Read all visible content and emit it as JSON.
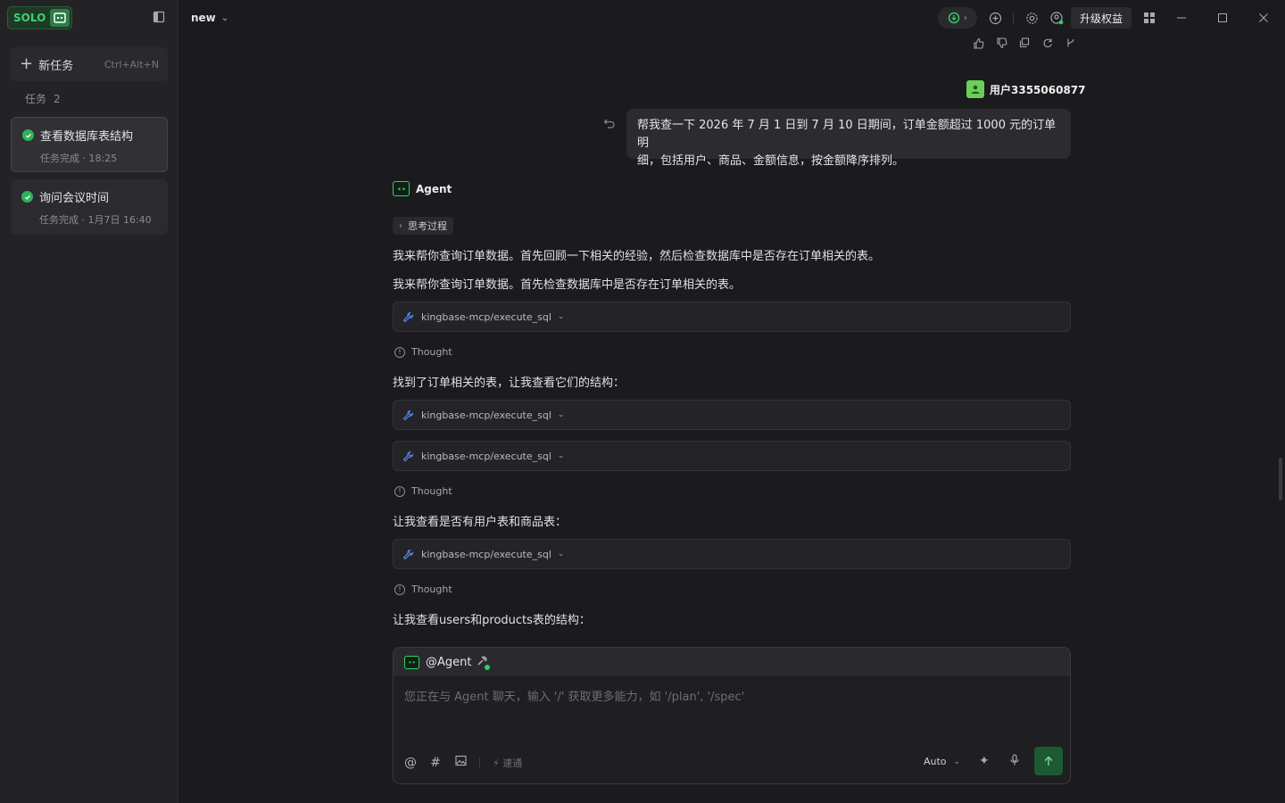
{
  "sidebar": {
    "logo_text": "SOLO",
    "new_task_label": "新任务",
    "new_task_shortcut": "Ctrl+Alt+N",
    "section_label": "任务",
    "section_count": "2",
    "tasks": [
      {
        "title": "查看数据库表结构",
        "subtitle": "任务完成 · 18:25"
      },
      {
        "title": "询问会议时间",
        "subtitle": "任务完成 · 1月7日 16:40"
      }
    ]
  },
  "topbar": {
    "project": "new",
    "upgrade_label": "升级权益"
  },
  "chat": {
    "user_name": "用户3355060877",
    "user_message_line1": "帮我查一下 2026 年 7 月 1 日到 7 月 10 日期间，订单金额超过 1000 元的订单明",
    "user_message_line2": "细，包括用户、商品、金额信息，按金额降序排列。",
    "agent_name": "Agent",
    "thinking_label": "思考过程",
    "para1": "我来帮你查询订单数据。首先回顾一下相关的经验，然后检查数据库中是否存在订单相关的表。",
    "para2": "我来帮你查询订单数据。首先检查数据库中是否存在订单相关的表。",
    "tool_label": "kingbase-mcp/execute_sql",
    "thought_label": "Thought",
    "para3": "找到了订单相关的表，让我查看它们的结构：",
    "para4": "让我查看是否有用户表和商品表：",
    "para5": "让我查看users和products表的结构："
  },
  "composer": {
    "mention": "@Agent",
    "placeholder": "您正在与 Agent 聊天，输入 '/' 获取更多能力，如 '/plan', '/spec'",
    "fast_label": "速通",
    "mode": "Auto"
  },
  "colors": {
    "accent_green": "#2fb25a",
    "send_bg": "#1d5a33",
    "tool_icon_blue": "#5c8cff"
  }
}
